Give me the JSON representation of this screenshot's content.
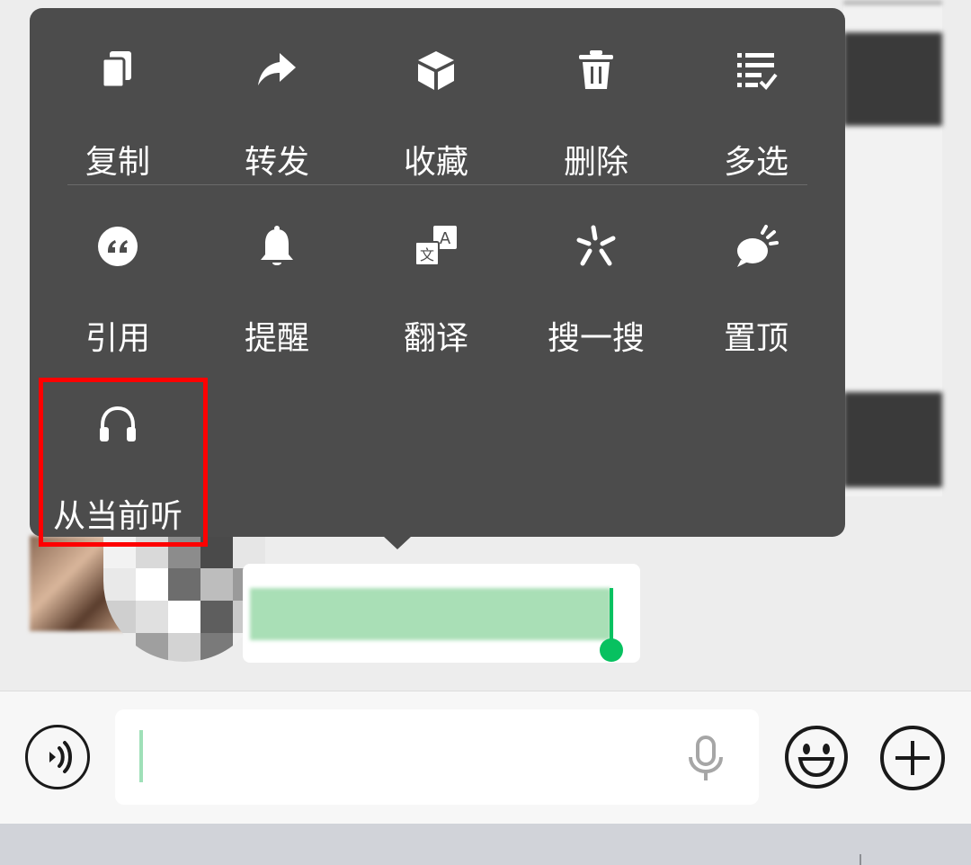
{
  "menu": {
    "row1": [
      {
        "label": "复制",
        "icon": "copy-icon"
      },
      {
        "label": "转发",
        "icon": "forward-icon"
      },
      {
        "label": "收藏",
        "icon": "favorite-cube-icon"
      },
      {
        "label": "删除",
        "icon": "trash-icon"
      },
      {
        "label": "多选",
        "icon": "multi-select-icon"
      }
    ],
    "row2": [
      {
        "label": "引用",
        "icon": "quote-icon"
      },
      {
        "label": "提醒",
        "icon": "bell-icon"
      },
      {
        "label": "翻译",
        "icon": "translate-icon"
      },
      {
        "label": "搜一搜",
        "icon": "search-sparkle-icon"
      },
      {
        "label": "置顶",
        "icon": "pin-top-icon"
      }
    ],
    "row3": [
      {
        "label": "从当前听",
        "icon": "headphones-icon"
      }
    ],
    "highlighted_item": "从当前听"
  },
  "colors": {
    "menu_bg": "#4c4c4c",
    "highlight_border": "#ff0000",
    "accent_green": "#07c160",
    "selected_text_bg": "#a9dfb6"
  },
  "input_bar": {
    "text_value": "",
    "icons": [
      "voice-mode-icon",
      "microphone-icon",
      "emoji-icon",
      "plus-icon"
    ]
  }
}
